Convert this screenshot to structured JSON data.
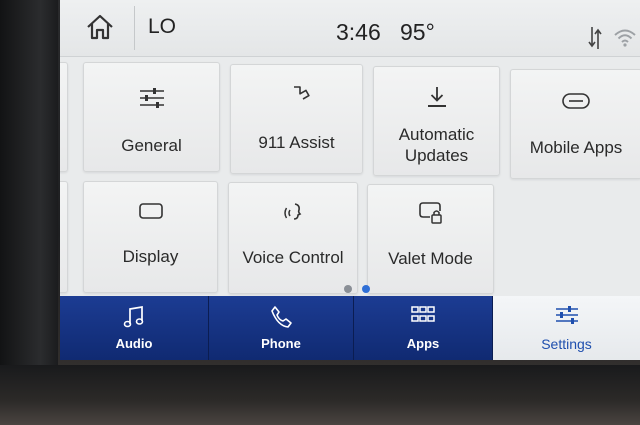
{
  "status_bar": {
    "home_icon": "house-icon",
    "climate_setting": "LO",
    "time": "3:46",
    "temperature": "95°",
    "sort_icon": "sort-arrows-icon",
    "wifi_icon": "wifi-icon"
  },
  "tiles": [
    {
      "label": "General",
      "icon": "sliders-icon"
    },
    {
      "label": "911 Assist",
      "icon": "emergency-asterisk-icon"
    },
    {
      "label_lines": [
        "Automatic",
        "Updates"
      ],
      "icon": "download-icon"
    },
    {
      "label": "Mobile Apps",
      "icon": "link-icon"
    },
    {
      "label": "Display",
      "icon": "display-icon"
    },
    {
      "label": "Voice Control",
      "icon": "voice-icon"
    },
    {
      "label": "Valet Mode",
      "icon": "lock-display-icon"
    }
  ],
  "pager": {
    "pages": 2,
    "current": 2
  },
  "nav": {
    "items": [
      {
        "label": "Audio",
        "icon": "music-note-icon"
      },
      {
        "label": "Phone",
        "icon": "phone-icon"
      },
      {
        "label": "Apps",
        "icon": "apps-grid-icon"
      },
      {
        "label": "Settings",
        "icon": "sliders-icon",
        "active": true
      }
    ]
  },
  "colors": {
    "nav_blue": "#1c3c93",
    "active_label": "#1f4fae",
    "pager_active": "#2f6fd6",
    "pager_inactive": "#8a8f96"
  }
}
